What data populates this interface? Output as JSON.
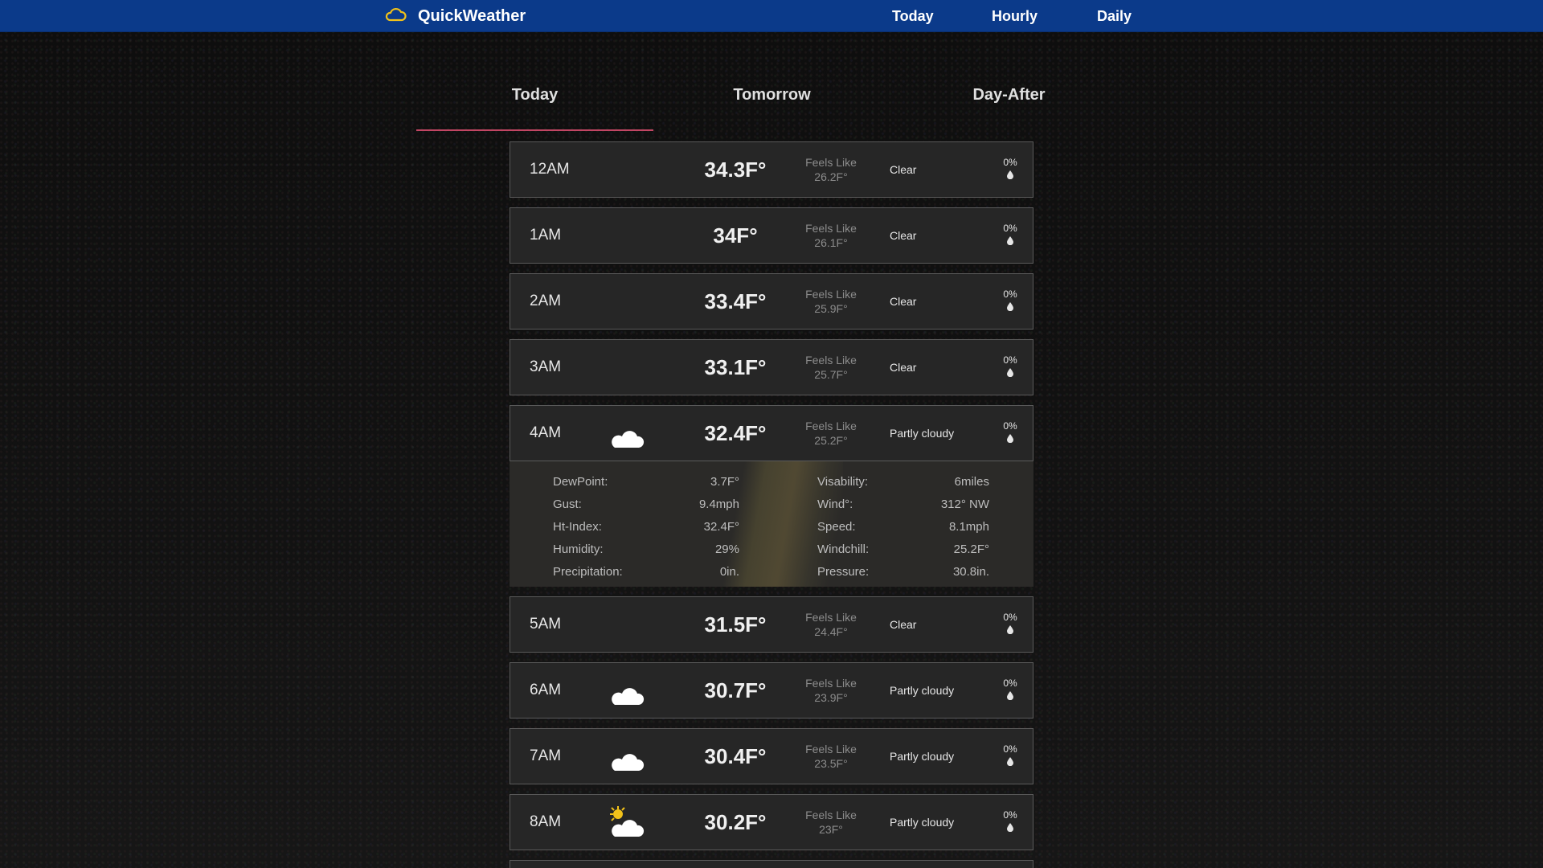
{
  "header": {
    "brand": "QuickWeather",
    "nav": [
      "Today",
      "Hourly",
      "Daily"
    ]
  },
  "tabs": [
    "Today",
    "Tomorrow",
    "Day-After"
  ],
  "active_tab": "Today",
  "colors": {
    "topbar": "#0b3a8a",
    "active_tab_underline": "#c24664",
    "row_bg": "#262626",
    "moon": "#1e6ff0",
    "sun": "#f2c21a"
  },
  "hours": [
    {
      "time": "12AM",
      "icon": "moon-icon",
      "temp": "34.3F°",
      "feels_label": "Feels Like",
      "feels": "26.2F°",
      "condition": "Clear",
      "precip": "0%"
    },
    {
      "time": "1AM",
      "icon": "moon-icon",
      "temp": "34F°",
      "feels_label": "Feels Like",
      "feels": "26.1F°",
      "condition": "Clear",
      "precip": "0%"
    },
    {
      "time": "2AM",
      "icon": "moon-icon",
      "temp": "33.4F°",
      "feels_label": "Feels Like",
      "feels": "25.9F°",
      "condition": "Clear",
      "precip": "0%"
    },
    {
      "time": "3AM",
      "icon": "moon-icon",
      "temp": "33.1F°",
      "feels_label": "Feels Like",
      "feels": "25.7F°",
      "condition": "Clear",
      "precip": "0%"
    },
    {
      "time": "4AM",
      "icon": "moon-cloud-icon",
      "temp": "32.4F°",
      "feels_label": "Feels Like",
      "feels": "25.2F°",
      "condition": "Partly cloudy",
      "precip": "0%"
    },
    {
      "time": "5AM",
      "icon": "moon-icon",
      "temp": "31.5F°",
      "feels_label": "Feels Like",
      "feels": "24.4F°",
      "condition": "Clear",
      "precip": "0%"
    },
    {
      "time": "6AM",
      "icon": "moon-cloud-icon",
      "temp": "30.7F°",
      "feels_label": "Feels Like",
      "feels": "23.9F°",
      "condition": "Partly cloudy",
      "precip": "0%"
    },
    {
      "time": "7AM",
      "icon": "moon-cloud-icon",
      "temp": "30.4F°",
      "feels_label": "Feels Like",
      "feels": "23.5F°",
      "condition": "Partly cloudy",
      "precip": "0%"
    },
    {
      "time": "8AM",
      "icon": "sun-cloud-icon",
      "temp": "30.2F°",
      "feels_label": "Feels Like",
      "feels": "23F°",
      "condition": "Partly cloudy",
      "precip": "0%"
    }
  ],
  "details": {
    "expanded_hour": "4AM",
    "left": [
      {
        "label": "DewPoint:",
        "value": "3.7F°"
      },
      {
        "label": "Gust:",
        "value": "9.4mph"
      },
      {
        "label": "Ht-Index:",
        "value": "32.4F°"
      },
      {
        "label": "Humidity:",
        "value": "29%"
      },
      {
        "label": "Precipitation:",
        "value": "0in."
      }
    ],
    "right": [
      {
        "label": "Visability:",
        "value": "6miles"
      },
      {
        "label": "Wind°:",
        "value": "312° NW"
      },
      {
        "label": "Speed:",
        "value": "8.1mph"
      },
      {
        "label": "Windchill:",
        "value": "25.2F°"
      },
      {
        "label": "Pressure:",
        "value": "30.8in."
      }
    ]
  }
}
